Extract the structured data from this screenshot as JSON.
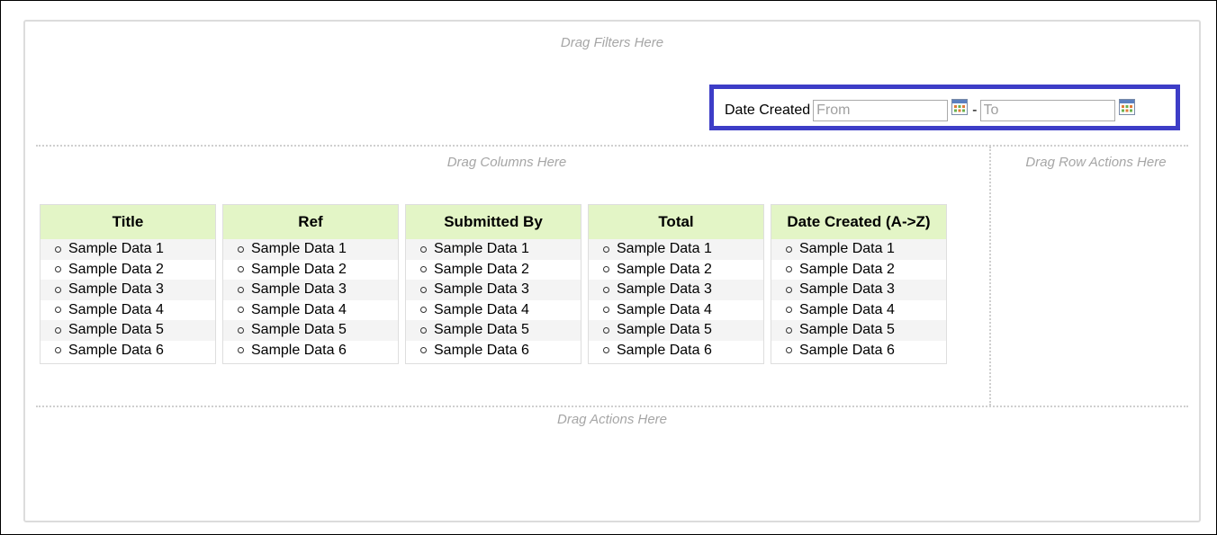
{
  "hints": {
    "filters": "Drag Filters Here",
    "columns": "Drag Columns Here",
    "row_actions": "Drag Row Actions Here",
    "actions": "Drag Actions Here"
  },
  "filter": {
    "label": "Date Created",
    "from_placeholder": "From",
    "separator": "-",
    "to_placeholder": "To",
    "icon": "calendar-icon",
    "highlight_color": "#3d3dc7"
  },
  "columns": [
    {
      "header": "Title",
      "items": [
        "Sample Data 1",
        "Sample Data 2",
        "Sample Data 3",
        "Sample Data 4",
        "Sample Data 5",
        "Sample Data 6"
      ]
    },
    {
      "header": "Ref",
      "items": [
        "Sample Data 1",
        "Sample Data 2",
        "Sample Data 3",
        "Sample Data 4",
        "Sample Data 5",
        "Sample Data 6"
      ]
    },
    {
      "header": "Submitted By",
      "items": [
        "Sample Data 1",
        "Sample Data 2",
        "Sample Data 3",
        "Sample Data 4",
        "Sample Data 5",
        "Sample Data 6"
      ]
    },
    {
      "header": "Total",
      "items": [
        "Sample Data 1",
        "Sample Data 2",
        "Sample Data 3",
        "Sample Data 4",
        "Sample Data 5",
        "Sample Data 6"
      ]
    },
    {
      "header": "Date Created (A->Z)",
      "items": [
        "Sample Data 1",
        "Sample Data 2",
        "Sample Data 3",
        "Sample Data 4",
        "Sample Data 5",
        "Sample Data 6"
      ]
    }
  ],
  "colors": {
    "header_bg": "#e3f5c6",
    "hint_text": "#a6a6a6"
  }
}
